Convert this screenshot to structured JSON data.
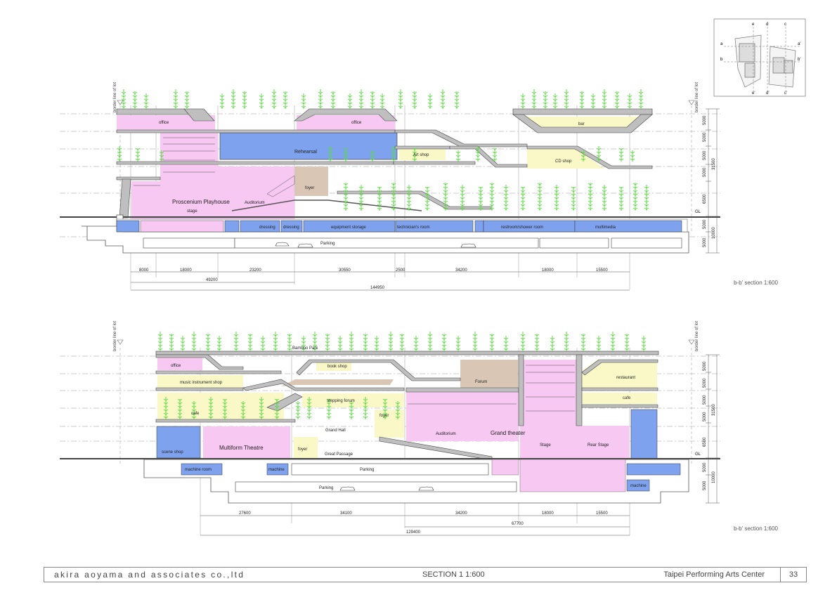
{
  "sections": [
    {
      "id": "upper",
      "caption": "b-b' section 1:600",
      "border_label_left": "border line of lot",
      "border_label_right": "border line of lot",
      "gl_label": "GL",
      "rooms": {
        "office_a": "office",
        "office_b": "office",
        "bar": "bar",
        "rehearsal": "Rehearsal",
        "art_shop": "Art shop",
        "cd_shop": "CD shop",
        "foyer": "foyer",
        "proscenium": "Proscenium Playhouse",
        "auditorium": "Auditorium",
        "stage": "stage",
        "dressing_a": "dressing",
        "dressing_b": "dressing",
        "equipment": "equipment storage",
        "technician": "technician's room",
        "restroom": "restroom/shower room",
        "multimedia": "multimedia",
        "parking": "Parking"
      },
      "right_dims": [
        "5000",
        "5000",
        "5000",
        "5000",
        "6500",
        "5000",
        "5000"
      ],
      "right_total_above": "31500",
      "right_total_below": "10000",
      "bottom_dims": [
        "8000",
        "18000",
        "23200",
        "30550",
        "2500",
        "34200",
        "18000",
        "15500"
      ],
      "subtotal": "49200",
      "total": "144950"
    },
    {
      "id": "lower",
      "caption": "b-b' section 1:600",
      "border_label_left": "border line of lot",
      "border_label_right": "border line of lot",
      "gl_label": "GL",
      "rooms": {
        "bamboo_park": "Bamboo Park",
        "office": "office",
        "book_shop": "book shop",
        "forum": "Forum",
        "restaurant": "restaurant",
        "music_shop": "music instrument shop",
        "stepping_forum": "stepping forum",
        "cafe_a": "cafe",
        "cafe_b": "cafe",
        "foyer_a": "foyer",
        "foyer_b": "foyer",
        "grand_hall": "Grand Hall",
        "great_passage": "Great Passage",
        "auditorium": "Auditorium",
        "grand_theater": "Grand theater",
        "stage": "Stage",
        "rear_stage": "Rear Stage",
        "scene_shop": "scene shop",
        "multiform": "Multiform Theatre",
        "machine_room": "machine room",
        "machine_a": "machine",
        "machine_b": "machine",
        "parking_a": "Parking",
        "parking_b": "Parking"
      },
      "right_dims": [
        "5000",
        "5000",
        "5000",
        "5000",
        "6500",
        "5000",
        "5000"
      ],
      "right_total_above": "31500",
      "right_total_below": "10000",
      "bottom_dims": [
        "27600",
        "34100",
        "34200",
        "18000",
        "15500"
      ],
      "subtotal": "67700",
      "total": "129400"
    }
  ],
  "keyplan": {
    "labels": [
      "a",
      "e",
      "d",
      "c",
      "a'",
      "b",
      "b'",
      "e'",
      "d'",
      "c'"
    ]
  },
  "footer": {
    "company": "akira aoyama and associates co.,ltd",
    "title": "SECTION 1  1:600",
    "project": "Taipei Performing Arts Center",
    "page": "33"
  },
  "colors": {
    "pink": "#f7c8f2",
    "blue": "#7fa2ef",
    "yellow": "#fbf8c8",
    "tan": "#d9c6b4",
    "bamboo": "#55dd3c",
    "structure": "#bfbfbf"
  }
}
